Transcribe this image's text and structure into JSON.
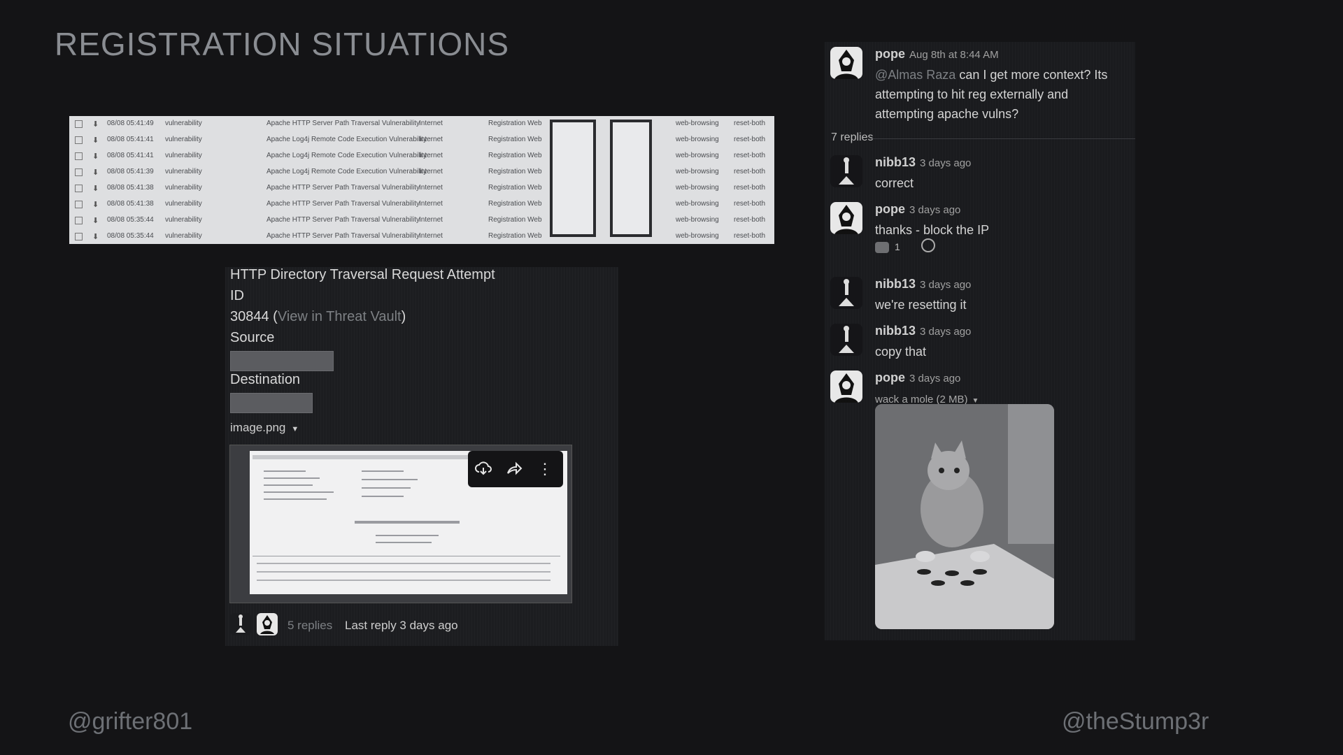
{
  "slide": {
    "title": "REGISTRATION SITUATIONS",
    "handle_left": "@grifter801",
    "handle_right": "@theStump3r"
  },
  "alert_table": {
    "rows": [
      {
        "time": "08/08 05:41:49",
        "type": "vulnerability",
        "name": "Apache HTTP Server Path Traversal Vulnerability",
        "zone": "Internet",
        "dest": "Registration Web",
        "app": "web-browsing",
        "action": "reset-both"
      },
      {
        "time": "08/08 05:41:41",
        "type": "vulnerability",
        "name": "Apache Log4j Remote Code Execution Vulnerability",
        "zone": "Internet",
        "dest": "Registration Web",
        "app": "web-browsing",
        "action": "reset-both"
      },
      {
        "time": "08/08 05:41:41",
        "type": "vulnerability",
        "name": "Apache Log4j Remote Code Execution Vulnerability",
        "zone": "Internet",
        "dest": "Registration Web",
        "app": "web-browsing",
        "action": "reset-both"
      },
      {
        "time": "08/08 05:41:39",
        "type": "vulnerability",
        "name": "Apache Log4j Remote Code Execution Vulnerability",
        "zone": "Internet",
        "dest": "Registration Web",
        "app": "web-browsing",
        "action": "reset-both"
      },
      {
        "time": "08/08 05:41:38",
        "type": "vulnerability",
        "name": "Apache HTTP Server Path Traversal Vulnerability",
        "zone": "Internet",
        "dest": "Registration Web",
        "app": "web-browsing",
        "action": "reset-both"
      },
      {
        "time": "08/08 05:41:38",
        "type": "vulnerability",
        "name": "Apache HTTP Server Path Traversal Vulnerability",
        "zone": "Internet",
        "dest": "Registration Web",
        "app": "web-browsing",
        "action": "reset-both"
      },
      {
        "time": "08/08 05:35:44",
        "type": "vulnerability",
        "name": "Apache HTTP Server Path Traversal Vulnerability",
        "zone": "Internet",
        "dest": "Registration Web",
        "app": "web-browsing",
        "action": "reset-both"
      },
      {
        "time": "08/08 05:35:44",
        "type": "vulnerability",
        "name": "Apache HTTP Server Path Traversal Vulnerability",
        "zone": "Internet",
        "dest": "Registration Web",
        "app": "web-browsing",
        "action": "reset-both"
      }
    ]
  },
  "threat": {
    "title": "HTTP Directory Traversal Request Attempt",
    "id_label": "ID",
    "id_value": "30844 (",
    "vault_link": "View in Threat Vault",
    "id_close": ")",
    "source_label": "Source",
    "destination_label": "Destination",
    "file_name": "image.png",
    "replies": "5 replies",
    "last_reply": "Last reply 3 days ago"
  },
  "thread": {
    "root": {
      "author": "pope",
      "time": "Aug 8th at 8:44 AM",
      "mention": "@Almas Raza",
      "text": "can I get more context? Its attempting to hit reg externally and attempting apache vulns?"
    },
    "reply_count": "7 replies",
    "messages": [
      {
        "author": "nibb13",
        "time": "3 days ago",
        "text": "correct"
      },
      {
        "author": "pope",
        "time": "3 days ago",
        "text": "thanks - block the IP",
        "reaction_count": "1"
      },
      {
        "author": "nibb13",
        "time": "3 days ago",
        "text": "we're resetting it"
      },
      {
        "author": "nibb13",
        "time": "3 days ago",
        "text": "copy that"
      },
      {
        "author": "pope",
        "time": "3 days ago",
        "file": "wack a mole (2 MB)"
      }
    ]
  },
  "icons": [
    "download-cloud-icon",
    "share-icon",
    "more-vertical-icon",
    "add-reaction-icon",
    "caret-down-icon"
  ]
}
